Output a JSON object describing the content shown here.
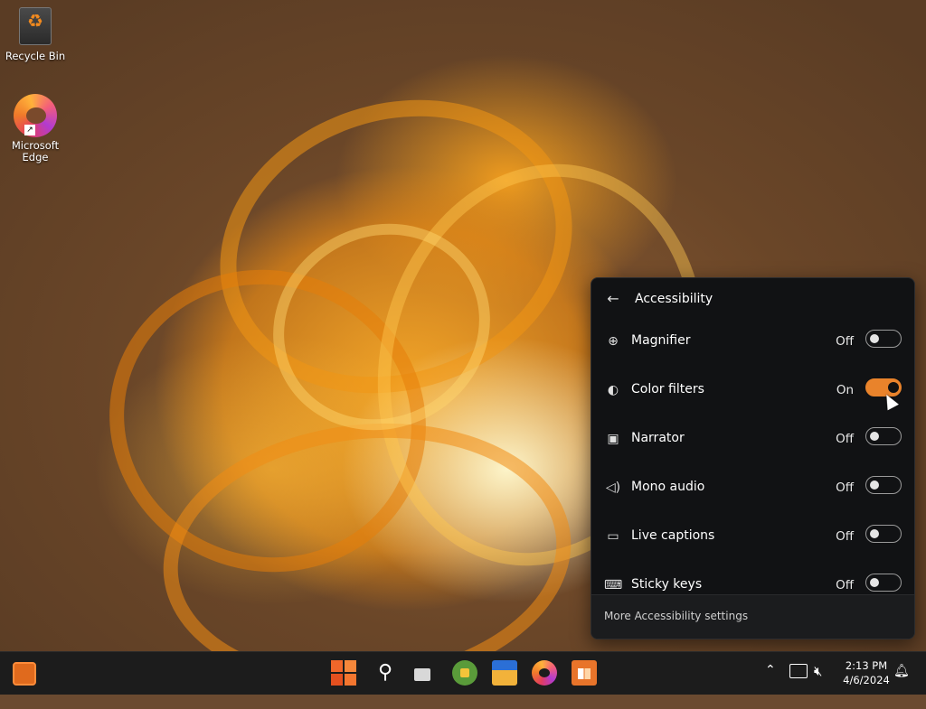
{
  "desktop": {
    "icons": [
      {
        "label": "Recycle Bin"
      },
      {
        "label": "Microsoft Edge"
      }
    ]
  },
  "flyout": {
    "title": "Accessibility",
    "back_icon": "back-arrow-icon",
    "rows": [
      {
        "label": "Magnifier",
        "state": "Off",
        "on": false,
        "icon": "magnifier-icon"
      },
      {
        "label": "Color filters",
        "state": "On",
        "on": true,
        "icon": "color-filters-icon"
      },
      {
        "label": "Narrator",
        "state": "Off",
        "on": false,
        "icon": "narrator-icon"
      },
      {
        "label": "Mono audio",
        "state": "Off",
        "on": false,
        "icon": "mono-audio-icon"
      },
      {
        "label": "Live captions",
        "state": "Off",
        "on": false,
        "icon": "live-captions-icon"
      },
      {
        "label": "Sticky keys",
        "state": "Off",
        "on": false,
        "icon": "sticky-keys-icon"
      }
    ],
    "footer_link": "More Accessibility settings",
    "accent_color": "#e9832b"
  },
  "taskbar": {
    "apps": [
      "widgets-icon",
      "start-icon",
      "search-icon",
      "task-view-icon",
      "chat-icon",
      "file-explorer-icon",
      "edge-icon",
      "store-icon"
    ],
    "tray": {
      "time": "2:13 PM",
      "date": "4/6/2024"
    }
  }
}
